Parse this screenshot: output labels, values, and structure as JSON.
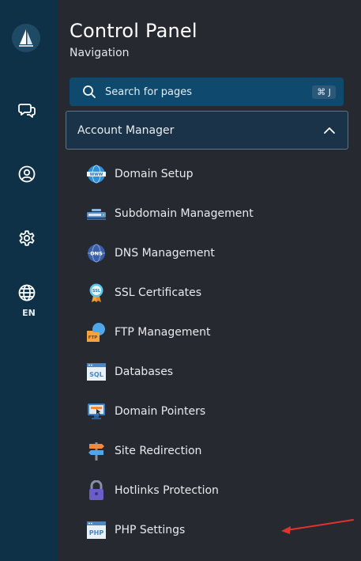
{
  "rail": {
    "language": "EN",
    "icons": [
      "sailboat-logo",
      "chat-icon",
      "user-icon",
      "gear-icon",
      "globe-icon"
    ]
  },
  "header": {
    "title": "Control Panel",
    "subtitle": "Navigation"
  },
  "search": {
    "placeholder": "Search for pages",
    "shortcut": "⌘ J"
  },
  "group": {
    "label": "Account Manager",
    "expanded": true
  },
  "items": [
    {
      "label": "Domain Setup",
      "icon": "www-globe-icon"
    },
    {
      "label": "Subdomain Management",
      "icon": "server-rack-icon"
    },
    {
      "label": "DNS Management",
      "icon": "dns-globe-icon"
    },
    {
      "label": "SSL Certificates",
      "icon": "ssl-badge-icon"
    },
    {
      "label": "FTP Management",
      "icon": "ftp-folder-icon"
    },
    {
      "label": "Databases",
      "icon": "sql-window-icon"
    },
    {
      "label": "Domain Pointers",
      "icon": "monitor-pointer-icon"
    },
    {
      "label": "Site Redirection",
      "icon": "signpost-icon"
    },
    {
      "label": "Hotlinks Protection",
      "icon": "padlock-icon"
    },
    {
      "label": "PHP Settings",
      "icon": "php-window-icon"
    }
  ],
  "colors": {
    "rail": "#0f3148",
    "panel": "#262930",
    "search": "#0f4a6e",
    "annotation_arrow": "#e0332a"
  }
}
